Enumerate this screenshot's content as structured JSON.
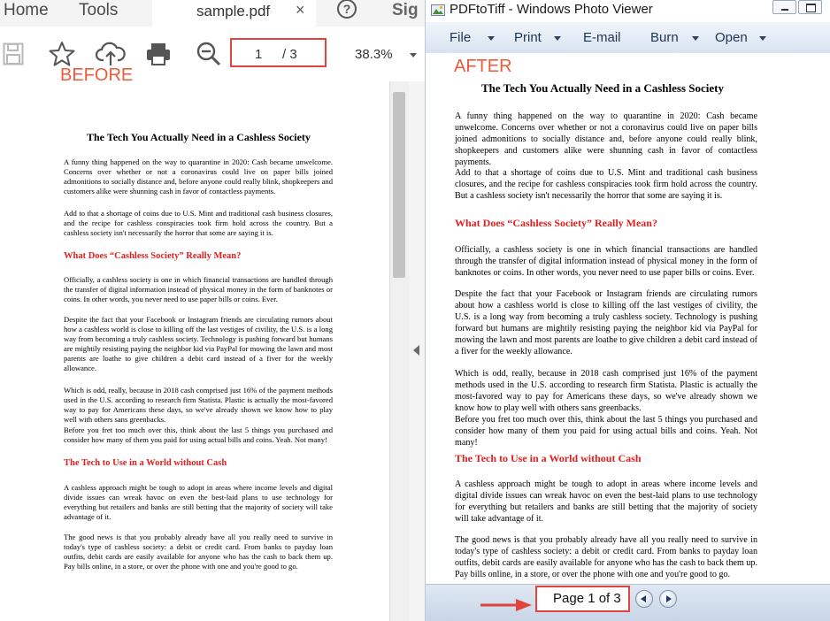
{
  "left_app": {
    "tabs": {
      "home": "Home",
      "tools": "Tools",
      "doc": "sample.pdf",
      "close": "×",
      "help": "?",
      "sign": "Sig"
    },
    "page_box": {
      "current": "1",
      "total": "/ 3"
    },
    "zoom": "38.3%",
    "before_label": "BEFORE"
  },
  "right_app": {
    "title": "PDFtoTiff - Windows Photo Viewer",
    "menu": [
      "File",
      "Print",
      "E-mail",
      "Burn",
      "Open"
    ],
    "after_label": "AFTER",
    "status": {
      "page_text": "Page 1 of 3"
    }
  },
  "document": {
    "title": "The Tech You Actually Need in a Cashless Society",
    "p1": "A funny thing happened on the way to quarantine in 2020: Cash became unwelcome. Concerns over whether or not a coronavirus could live on paper bills joined admonitions to socially distance and, before anyone could really blink, shopkeepers and customers alike were shunning cash in favor of contactless payments.",
    "p2": "Add to that a shortage of coins due to U.S. Mint and traditional cash business closures, and the recipe for cashless conspiracies took firm hold across the country. But a cashless society isn't necessarily the horror that some are saying it is.",
    "h1": "What Does “Cashless Society” Really Mean?",
    "p3": "Officially, a cashless society is one in which financial transactions are handled through the transfer of digital information instead of physical money in the form of banknotes or coins. In other words, you never need to use paper bills or coins. Ever.",
    "p4": "Despite the fact that your Facebook or Instagram friends are circulating rumors about how a cashless world is close to killing off the last vestiges of civility, the U.S. is a long way from becoming a truly cashless society. Technology is pushing forward but humans are mightily resisting paying the neighbor kid via PayPal for mowing the lawn and most parents are loathe to give children a debit card instead of a fiver for the weekly allowance.",
    "p5": "Which is odd, really, because in 2018 cash comprised just 16% of the payment methods used in the U.S. according to research firm Statista. Plastic is actually the most-favored way to pay for Americans these days, so we've already shown we know how to play well with others sans greenbacks.",
    "p6": "Before you fret too much over this, think about the last 5 things you purchased and consider how many of them you paid for using actual bills and coins. Yeah. Not many!",
    "h2": "The Tech to Use in a World without Cash",
    "p7": "A cashless approach might be tough to adopt in areas where income levels and digital divide issues can wreak havoc on even the best-laid plans to use technology for everything but retailers and banks are still betting that the majority of society will take advantage of it.",
    "p8": "The good news is that you probably already have all you really need to survive in today's type of cashless society: a debit or credit card. From banks to payday loan outfits, debit cards are easily available for anyone who has the cash to back them up. Pay bills online, in a store, or over the phone with one and you're good to go."
  }
}
